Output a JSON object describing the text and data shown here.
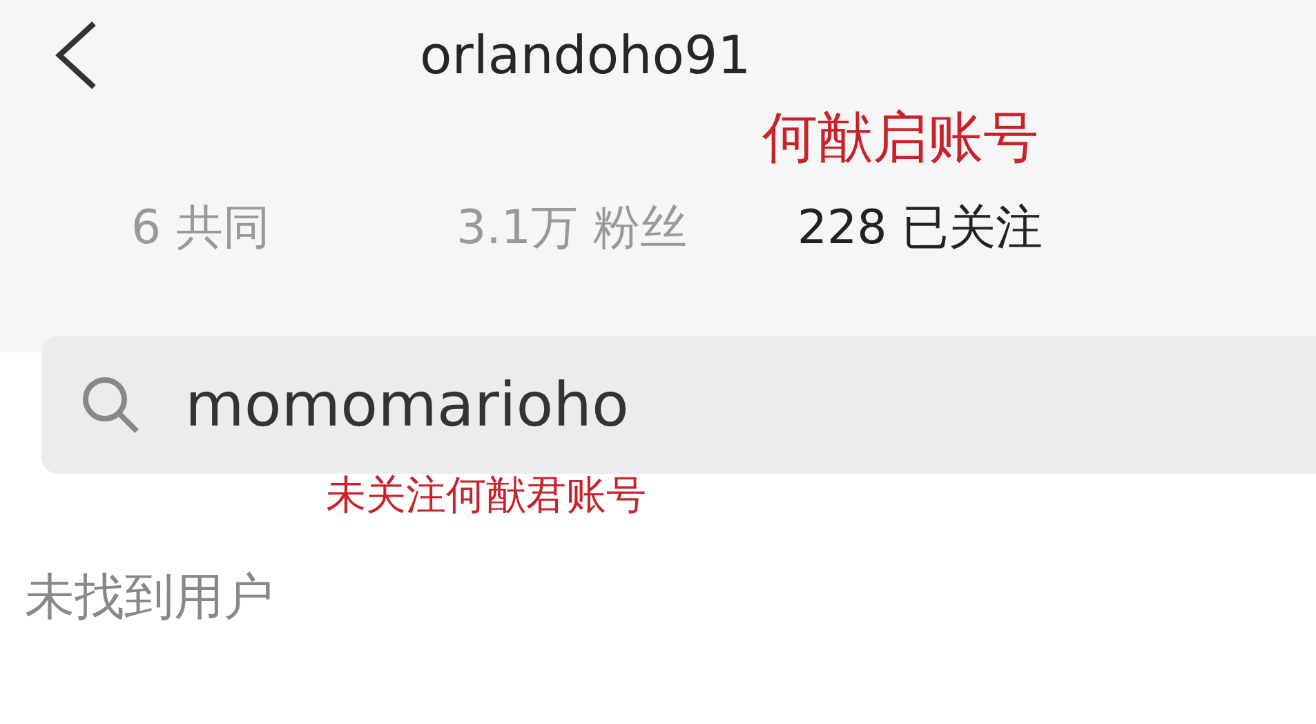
{
  "header": {
    "title": "orlandoho91"
  },
  "annotation_top": "何猷启账号",
  "stats": [
    {
      "number": "6",
      "label": "共同",
      "emphasis": false
    },
    {
      "number": "3.1万",
      "label": "粉丝",
      "emphasis": false
    },
    {
      "number": "228",
      "label": "已关注",
      "emphasis": true
    }
  ],
  "search": {
    "value": "momomarioho"
  },
  "annotation_search": "未关注何猷君账号",
  "result": "未找到用户"
}
